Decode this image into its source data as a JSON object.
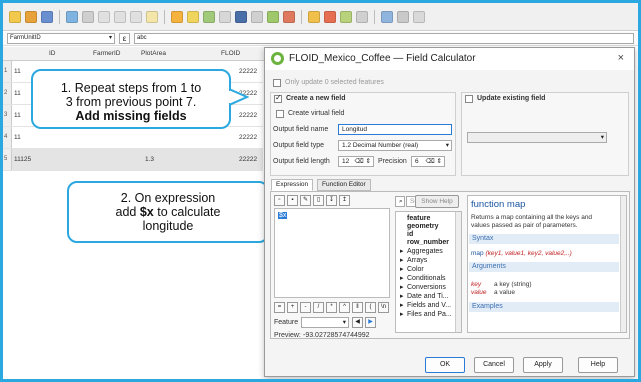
{
  "table": {
    "field_selector": "FarmUnitID",
    "expression_value": "abc",
    "headers": [
      "ID",
      "FarmerID",
      "PlotArea",
      "FLOID"
    ],
    "rows": [
      {
        "num": "1",
        "id": "11",
        "plot": "",
        "floid": "22222"
      },
      {
        "num": "2",
        "id": "11",
        "plot": "",
        "floid": "22222"
      },
      {
        "num": "3",
        "id": "11",
        "plot": "",
        "floid": "22222"
      },
      {
        "num": "4",
        "id": "11",
        "plot": "",
        "floid": "22222"
      },
      {
        "num": "5",
        "id": "11125",
        "plot": "1.3",
        "floid": "22222"
      }
    ]
  },
  "callouts": {
    "step1_line1": "1.  Repeat steps from 1 to",
    "step1_line2": "3 from previous point 7.",
    "step1_bold": "Add missing fields",
    "step2_line1": "2. On expression",
    "step2_pre": "add ",
    "step2_bold": "$x",
    "step2_post": " to calculate",
    "step2_line3": "longitude"
  },
  "dialog": {
    "title": "FLOID_Mexico_Coffee — Field Calculator",
    "close": "×",
    "only_update": "Only update 0 selected features",
    "create_new_field": "Create a new field",
    "update_existing": "Update existing field",
    "create_virtual": "Create virtual field",
    "output_name_label": "Output field name",
    "output_name_value": "Longitud",
    "output_type_label": "Output field type",
    "output_type_value": "1.2  Decimal Number (real)",
    "output_length_label": "Output field length",
    "output_length_value": "12",
    "precision_label": "Precision",
    "precision_value": "6",
    "tab_expression": "Expression",
    "tab_function_editor": "Function Editor",
    "expression_text": "$x",
    "search_placeholder": "Search",
    "show_help": "Show Help",
    "feature_label": "Feature",
    "preview_label": "Preview:",
    "preview_value": "-93.02728574744992",
    "tree": [
      "feature",
      "geometry",
      "id",
      "row_number"
    ],
    "tree_groups": [
      "Aggregates",
      "Arrays",
      "Color",
      "Conditionals",
      "Conversions",
      "Date and Ti...",
      "Fields and V...",
      "Files and Pa..."
    ],
    "help_title": "function map",
    "help_desc_1": "Returns a map containing all the keys and",
    "help_desc_2": "values passed as pair of parameters.",
    "syntax_head": "Syntax",
    "syntax_fn": "map",
    "syntax_args": "(key1, value1, key2, value2,..)",
    "arguments_head": "Arguments",
    "arg1_name": "key",
    "arg1_desc": "a key (string)",
    "arg2_name": "value",
    "arg2_desc": "a value",
    "examples_head": "Examples",
    "ok": "OK",
    "cancel": "Cancel",
    "apply": "Apply",
    "help": "Help"
  }
}
